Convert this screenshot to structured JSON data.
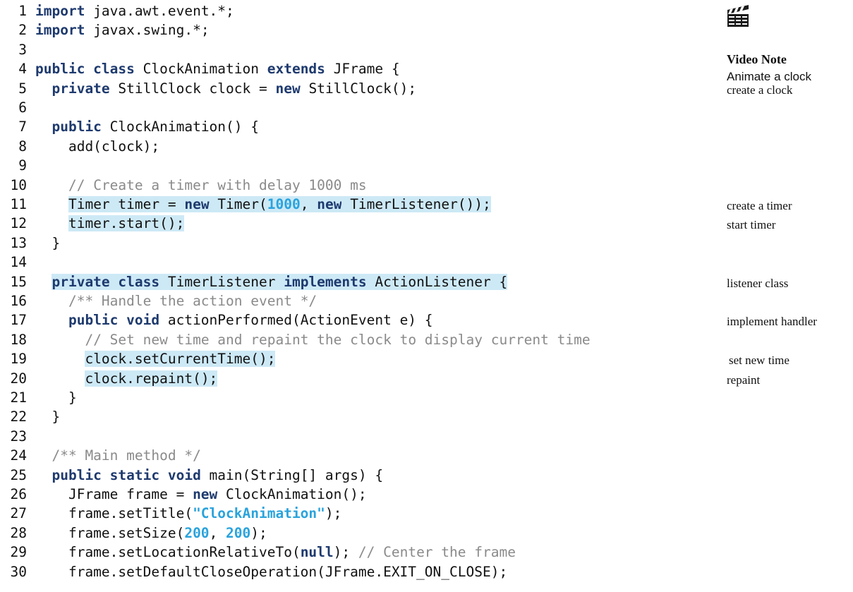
{
  "video_note": {
    "title": "Video Note",
    "subtitle": "Animate a clock",
    "icon": "clapperboard-icon"
  },
  "colors": {
    "keyword": "#1e3a6e",
    "literal": "#2aa3dc",
    "comment": "#8a8a8a",
    "highlight": "#cde9f6"
  },
  "lines": [
    {
      "num": "1",
      "highlight": false,
      "tokens": [
        {
          "t": "import",
          "c": "kw"
        },
        {
          "t": " java.awt.event.*;",
          "c": ""
        }
      ]
    },
    {
      "num": "2",
      "highlight": false,
      "tokens": [
        {
          "t": "import",
          "c": "kw"
        },
        {
          "t": " javax.swing.*;",
          "c": ""
        }
      ]
    },
    {
      "num": "3",
      "highlight": false,
      "tokens": []
    },
    {
      "num": "4",
      "highlight": false,
      "tokens": [
        {
          "t": "public class",
          "c": "kw"
        },
        {
          "t": " ClockAnimation ",
          "c": ""
        },
        {
          "t": "extends",
          "c": "kw"
        },
        {
          "t": " JFrame {",
          "c": ""
        }
      ]
    },
    {
      "num": "5",
      "highlight": false,
      "tokens": [
        {
          "t": "  ",
          "c": ""
        },
        {
          "t": "private",
          "c": "kw"
        },
        {
          "t": " StillClock clock = ",
          "c": ""
        },
        {
          "t": "new",
          "c": "kw"
        },
        {
          "t": " StillClock();",
          "c": ""
        }
      ]
    },
    {
      "num": "6",
      "highlight": false,
      "tokens": []
    },
    {
      "num": "7",
      "highlight": false,
      "tokens": [
        {
          "t": "  ",
          "c": ""
        },
        {
          "t": "public",
          "c": "kw"
        },
        {
          "t": " ClockAnimation() {",
          "c": ""
        }
      ]
    },
    {
      "num": "8",
      "highlight": false,
      "tokens": [
        {
          "t": "    add(clock);",
          "c": ""
        }
      ]
    },
    {
      "num": "9",
      "highlight": false,
      "tokens": []
    },
    {
      "num": "10",
      "highlight": false,
      "tokens": [
        {
          "t": "    ",
          "c": ""
        },
        {
          "t": "// Create a timer with delay 1000 ms",
          "c": "cmt"
        }
      ]
    },
    {
      "num": "11",
      "highlight": true,
      "tokens": [
        {
          "t": "    ",
          "c": ""
        },
        {
          "t": "Timer timer = ",
          "c": "",
          "h": true
        },
        {
          "t": "new",
          "c": "kw",
          "h": true
        },
        {
          "t": " Timer(",
          "c": "",
          "h": true
        },
        {
          "t": "1000",
          "c": "num",
          "h": true
        },
        {
          "t": ", ",
          "c": "",
          "h": true
        },
        {
          "t": "new",
          "c": "kw",
          "h": true
        },
        {
          "t": " TimerListener());",
          "c": "",
          "h": true
        }
      ]
    },
    {
      "num": "12",
      "highlight": true,
      "tokens": [
        {
          "t": "    ",
          "c": ""
        },
        {
          "t": "timer.start();",
          "c": "",
          "h": true
        }
      ]
    },
    {
      "num": "13",
      "highlight": false,
      "tokens": [
        {
          "t": "  }",
          "c": ""
        }
      ]
    },
    {
      "num": "14",
      "highlight": false,
      "tokens": []
    },
    {
      "num": "15",
      "highlight": true,
      "tokens": [
        {
          "t": "  ",
          "c": ""
        },
        {
          "t": "private class",
          "c": "kw",
          "h": true
        },
        {
          "t": " TimerListener ",
          "c": "",
          "h": true
        },
        {
          "t": "implements",
          "c": "kw",
          "h": true
        },
        {
          "t": " ActionListener {",
          "c": "",
          "h": true
        }
      ]
    },
    {
      "num": "16",
      "highlight": false,
      "tokens": [
        {
          "t": "    ",
          "c": ""
        },
        {
          "t": "/** Handle the action event */",
          "c": "cmt"
        }
      ]
    },
    {
      "num": "17",
      "highlight": false,
      "tokens": [
        {
          "t": "    ",
          "c": ""
        },
        {
          "t": "public void",
          "c": "kw"
        },
        {
          "t": " actionPerformed(ActionEvent e) {",
          "c": ""
        }
      ]
    },
    {
      "num": "18",
      "highlight": false,
      "tokens": [
        {
          "t": "      ",
          "c": ""
        },
        {
          "t": "// Set new time and repaint the clock to display current time",
          "c": "cmt"
        }
      ]
    },
    {
      "num": "19",
      "highlight": true,
      "tokens": [
        {
          "t": "      ",
          "c": ""
        },
        {
          "t": "clock.setCurrentTime();",
          "c": "",
          "h": true
        }
      ]
    },
    {
      "num": "20",
      "highlight": true,
      "tokens": [
        {
          "t": "      ",
          "c": ""
        },
        {
          "t": "clock.repaint();",
          "c": "",
          "h": true
        }
      ]
    },
    {
      "num": "21",
      "highlight": false,
      "tokens": [
        {
          "t": "    }",
          "c": ""
        }
      ]
    },
    {
      "num": "22",
      "highlight": false,
      "tokens": [
        {
          "t": "  }",
          "c": ""
        }
      ]
    },
    {
      "num": "23",
      "highlight": false,
      "tokens": []
    },
    {
      "num": "24",
      "highlight": false,
      "tokens": [
        {
          "t": "  ",
          "c": ""
        },
        {
          "t": "/** Main method */",
          "c": "cmt"
        }
      ]
    },
    {
      "num": "25",
      "highlight": false,
      "tokens": [
        {
          "t": "  ",
          "c": ""
        },
        {
          "t": "public static void",
          "c": "kw"
        },
        {
          "t": " main(String[] args) {",
          "c": ""
        }
      ]
    },
    {
      "num": "26",
      "highlight": false,
      "tokens": [
        {
          "t": "    JFrame frame = ",
          "c": ""
        },
        {
          "t": "new",
          "c": "kw"
        },
        {
          "t": " ClockAnimation();",
          "c": ""
        }
      ]
    },
    {
      "num": "27",
      "highlight": false,
      "tokens": [
        {
          "t": "    frame.setTitle(",
          "c": ""
        },
        {
          "t": "\"ClockAnimation\"",
          "c": "str"
        },
        {
          "t": ");",
          "c": ""
        }
      ]
    },
    {
      "num": "28",
      "highlight": false,
      "tokens": [
        {
          "t": "    frame.setSize(",
          "c": ""
        },
        {
          "t": "200",
          "c": "num"
        },
        {
          "t": ", ",
          "c": ""
        },
        {
          "t": "200",
          "c": "num"
        },
        {
          "t": ");",
          "c": ""
        }
      ]
    },
    {
      "num": "29",
      "highlight": false,
      "tokens": [
        {
          "t": "    frame.setLocationRelativeTo(",
          "c": ""
        },
        {
          "t": "null",
          "c": "kw"
        },
        {
          "t": "); ",
          "c": ""
        },
        {
          "t": "// Center the frame",
          "c": "cmt"
        }
      ]
    },
    {
      "num": "30",
      "highlight": false,
      "tokens": [
        {
          "t": "    frame.setDefaultCloseOperation(JFrame.EXIT_ON_CLOSE);",
          "c": ""
        }
      ]
    }
  ],
  "margin_notes": [
    {
      "line": "5",
      "text": "create a clock"
    },
    {
      "line": "11",
      "text": "create a timer"
    },
    {
      "line": "12",
      "text": "start timer"
    },
    {
      "line": "15",
      "text": "listener class"
    },
    {
      "line": "17",
      "text": "implement handler"
    },
    {
      "line": "19",
      "text": "set new time"
    },
    {
      "line": "20",
      "text": "repaint"
    }
  ]
}
